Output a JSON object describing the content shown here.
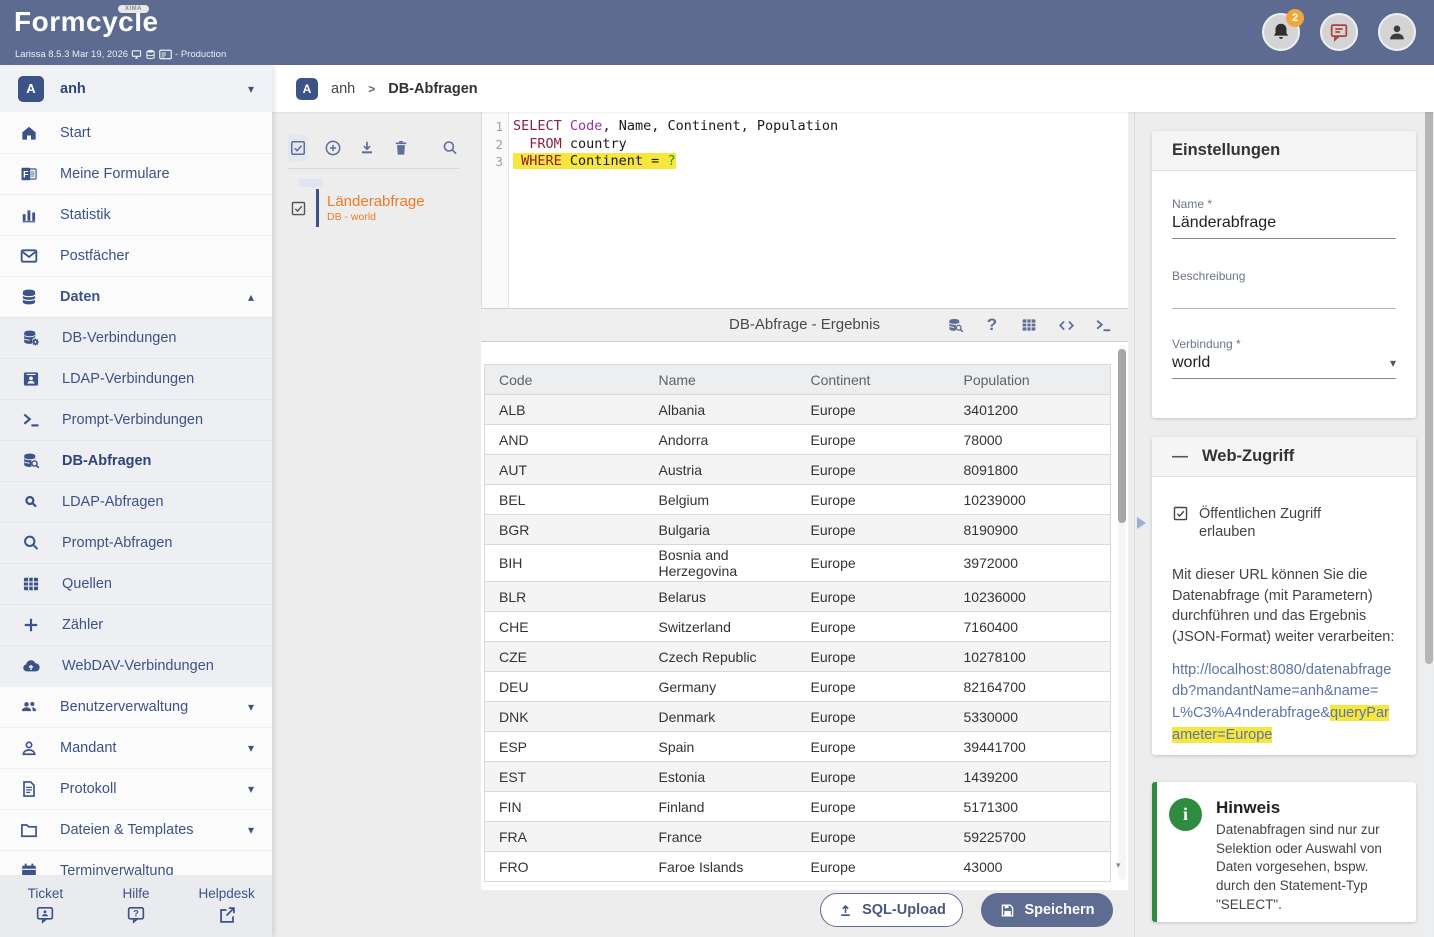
{
  "header": {
    "logo_text": "Formcycle",
    "logo_badge": "XIMA",
    "version_info": "Larissa 8.5.3 Mar 19, 2026",
    "environment": "- Production",
    "notification_badge": "2"
  },
  "breadcrumb": {
    "client_initial": "A",
    "client": "anh",
    "separator": ">",
    "page": "DB-Abfragen"
  },
  "sidebar": {
    "client": {
      "initial": "A",
      "name": "anh"
    },
    "items": [
      {
        "label": "Start"
      },
      {
        "label": "Meine Formulare"
      },
      {
        "label": "Statistik"
      },
      {
        "label": "Postfächer"
      },
      {
        "label": "Daten"
      }
    ],
    "sub_items": [
      {
        "label": "DB-Verbindungen"
      },
      {
        "label": "LDAP-Verbindungen"
      },
      {
        "label": "Prompt-Verbindungen"
      },
      {
        "label": "DB-Abfragen"
      },
      {
        "label": "LDAP-Abfragen"
      },
      {
        "label": "Prompt-Abfragen"
      },
      {
        "label": "Quellen"
      },
      {
        "label": "Zähler"
      },
      {
        "label": "WebDAV-Verbindungen"
      }
    ],
    "bottom_items": [
      {
        "label": "Benutzerverwaltung"
      },
      {
        "label": "Mandant"
      },
      {
        "label": "Protokoll"
      },
      {
        "label": "Dateien & Templates"
      },
      {
        "label": "Terminverwaltung"
      }
    ],
    "footer_items": [
      {
        "label": "Ticket"
      },
      {
        "label": "Hilfe"
      },
      {
        "label": "Helpdesk"
      }
    ]
  },
  "list_panel": {
    "item": {
      "title": "Länderabfrage",
      "subtitle": "DB - world"
    }
  },
  "editor": {
    "lines": [
      {
        "highlight": false,
        "tokens": [
          {
            "text": "SELECT",
            "type": "keyword"
          },
          {
            "text": " ",
            "type": "plain"
          },
          {
            "text": "Code",
            "type": "builtin"
          },
          {
            "text": ", Name, Continent, Population",
            "type": "plain"
          }
        ]
      },
      {
        "highlight": false,
        "tokens": [
          {
            "text": "  ",
            "type": "plain"
          },
          {
            "text": "FROM",
            "type": "keyword"
          },
          {
            "text": " country",
            "type": "plain"
          }
        ]
      },
      {
        "highlight": true,
        "tokens": [
          {
            "text": " ",
            "type": "plain"
          },
          {
            "text": "WHERE",
            "type": "keyword"
          },
          {
            "text": " Continent = ",
            "type": "plain"
          },
          {
            "text": "?",
            "type": "param"
          }
        ]
      }
    ]
  },
  "result_panel": {
    "title": "DB-Abfrage - Ergebnis"
  },
  "result_table": {
    "columns": [
      "Code",
      "Name",
      "Continent",
      "Population"
    ],
    "rows": [
      [
        "ALB",
        "Albania",
        "Europe",
        "3401200"
      ],
      [
        "AND",
        "Andorra",
        "Europe",
        "78000"
      ],
      [
        "AUT",
        "Austria",
        "Europe",
        "8091800"
      ],
      [
        "BEL",
        "Belgium",
        "Europe",
        "10239000"
      ],
      [
        "BGR",
        "Bulgaria",
        "Europe",
        "8190900"
      ],
      [
        "BIH",
        "Bosnia and Herzegovina",
        "Europe",
        "3972000"
      ],
      [
        "BLR",
        "Belarus",
        "Europe",
        "10236000"
      ],
      [
        "CHE",
        "Switzerland",
        "Europe",
        "7160400"
      ],
      [
        "CZE",
        "Czech Republic",
        "Europe",
        "10278100"
      ],
      [
        "DEU",
        "Germany",
        "Europe",
        "82164700"
      ],
      [
        "DNK",
        "Denmark",
        "Europe",
        "5330000"
      ],
      [
        "ESP",
        "Spain",
        "Europe",
        "39441700"
      ],
      [
        "EST",
        "Estonia",
        "Europe",
        "1439200"
      ],
      [
        "FIN",
        "Finland",
        "Europe",
        "5171300"
      ],
      [
        "FRA",
        "France",
        "Europe",
        "59225700"
      ],
      [
        "FRO",
        "Faroe Islands",
        "Europe",
        "43000"
      ]
    ]
  },
  "actions": {
    "sql_upload": "SQL-Upload",
    "save": "Speichern"
  },
  "settings_card": {
    "title": "Einstellungen",
    "name_label": "Name *",
    "name_value": "Länderabfrage",
    "description_label": "Beschreibung",
    "description_value": "",
    "connection_label": "Verbindung *",
    "connection_value": "world"
  },
  "web_access_card": {
    "title": "Web-Zugriff",
    "checkbox_label": "Öffentlichen Zugriff erlauben",
    "description": "Mit dieser URL können Sie die Datenabfrage (mit Parametern) durchführen und das Ergebnis (JSON-Format) weiter verarbeiten:",
    "url_plain": "http://localhost:8080/datenabfragedb?mandantName=anh&name=L%C3%A4nderabfrage&",
    "url_highlighted": "queryParameter=Europe"
  },
  "hinweis_card": {
    "title": "Hinweis",
    "text": "Datenabfragen sind nur zur Selektion oder Auswahl von Daten vorgesehen, bspw. durch den Statement-Typ \"SELECT\"."
  },
  "colors": {
    "topbar": "#5c6b8f",
    "sidebar_blue": "#3c5387",
    "orange_accent": "#ec7a24",
    "highlight_yellow": "#f7e63d",
    "link_blue": "#5b74a8",
    "success_green": "#2e8b40",
    "save_button": "#5d6c90"
  }
}
